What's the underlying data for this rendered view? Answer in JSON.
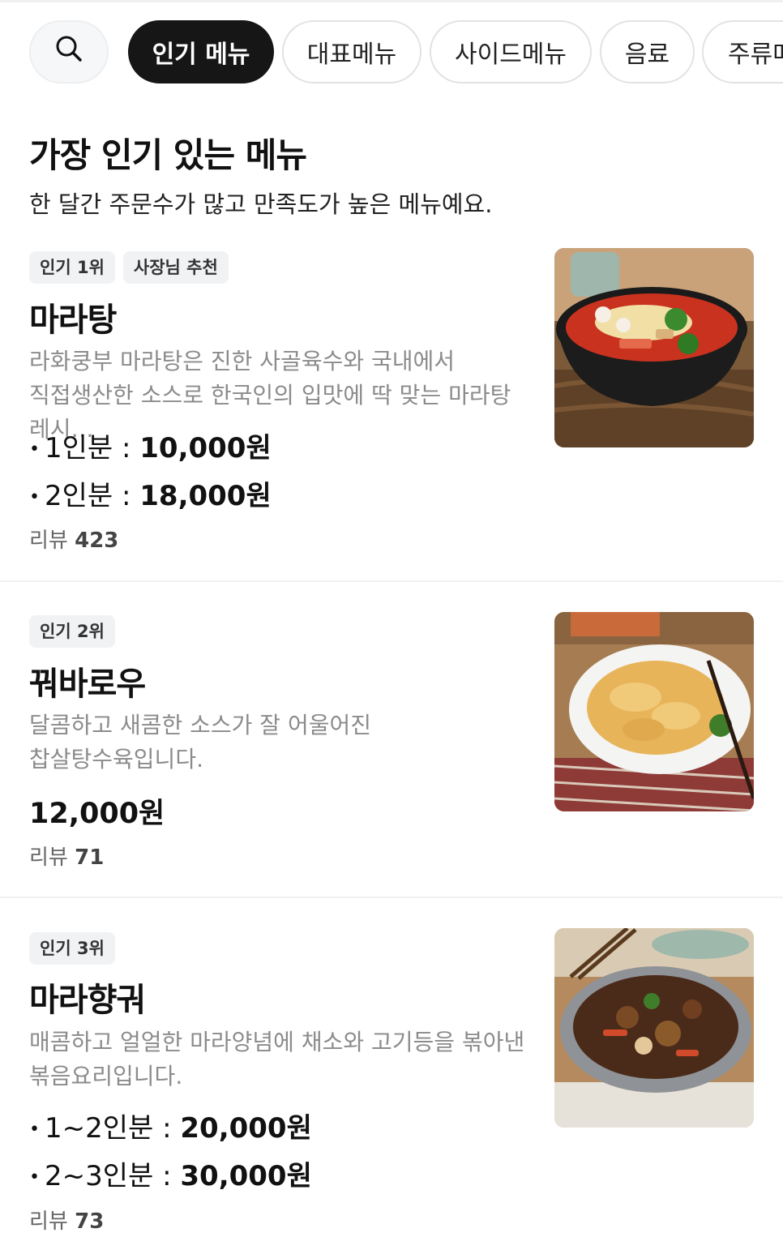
{
  "categories": {
    "search_icon": "search-icon",
    "items": [
      "인기 메뉴",
      "대표메뉴",
      "사이드메뉴",
      "음료",
      "주류메"
    ]
  },
  "section": {
    "title": "가장 인기 있는 메뉴",
    "subtitle": "한 달간 주문수가 많고 만족도가 높은 메뉴예요."
  },
  "menu": [
    {
      "badges": [
        "인기 1위",
        "사장님 추천"
      ],
      "name": "마라탕",
      "description": "라화쿵부 마라탕은 진한 사골육수와 국내에서 직접생산한 소스로 한국인의 입맛에 딱 맞는 마라탕 레시…",
      "prices": [
        {
          "label": "1인분 : ",
          "amount": "10,000원"
        },
        {
          "label": "2인분 : ",
          "amount": "18,000원"
        }
      ],
      "review_label": "리뷰",
      "review_count": "423",
      "image": "malatang-bowl-photo"
    },
    {
      "badges": [
        "인기 2위"
      ],
      "name": "꿔바로우",
      "description": "달콤하고 새콤한 소스가  잘 어울어진 찹살탕수육입니다.",
      "price": "12,000원",
      "review_label": "리뷰",
      "review_count": "71",
      "image": "guobaorou-plate-photo"
    },
    {
      "badges": [
        "인기 3위"
      ],
      "name": "마라향궈",
      "description": "매콤하고 얼얼한 마라양념에 채소와 고기등을 볶아낸 볶음요리입니다.",
      "prices": [
        {
          "label": "1~2인분 : ",
          "amount": "20,000원"
        },
        {
          "label": "2~3인분 : ",
          "amount": "30,000원"
        }
      ],
      "review_label": "리뷰",
      "review_count": "73",
      "image": "malaxiangguo-pan-photo"
    }
  ]
}
